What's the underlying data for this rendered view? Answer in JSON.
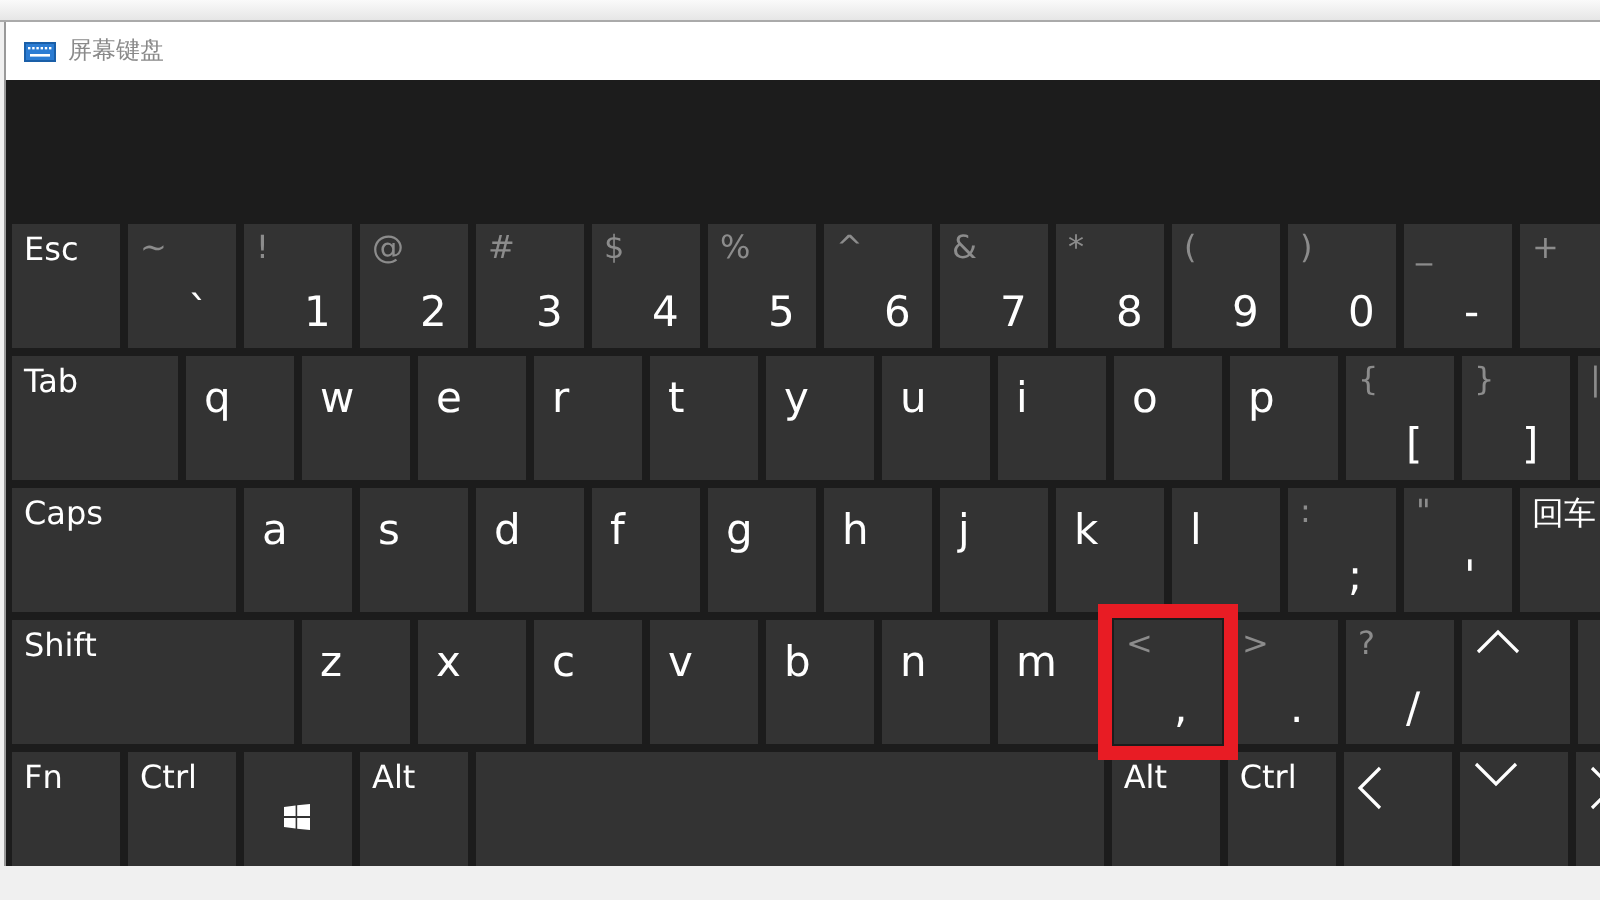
{
  "window": {
    "title": "屏幕键盘"
  },
  "rows": [
    {
      "keys": [
        {
          "kind": "func",
          "label": "Esc"
        },
        {
          "kind": "char",
          "shift": "~",
          "main": "`"
        },
        {
          "kind": "char",
          "shift": "!",
          "main": "1"
        },
        {
          "kind": "char",
          "shift": "@",
          "main": "2"
        },
        {
          "kind": "char",
          "shift": "#",
          "main": "3"
        },
        {
          "kind": "char",
          "shift": "$",
          "main": "4"
        },
        {
          "kind": "char",
          "shift": "%",
          "main": "5"
        },
        {
          "kind": "char",
          "shift": "^",
          "main": "6"
        },
        {
          "kind": "char",
          "shift": "&",
          "main": "7"
        },
        {
          "kind": "char",
          "shift": "*",
          "main": "8"
        },
        {
          "kind": "char",
          "shift": "(",
          "main": "9"
        },
        {
          "kind": "char",
          "shift": ")",
          "main": "0"
        },
        {
          "kind": "char",
          "shift": "_",
          "main": "-"
        },
        {
          "kind": "char",
          "shift": "+"
        }
      ]
    },
    {
      "keys": [
        {
          "kind": "func",
          "label": "Tab"
        },
        {
          "kind": "letter",
          "label": "q"
        },
        {
          "kind": "letter",
          "label": "w"
        },
        {
          "kind": "letter",
          "label": "e"
        },
        {
          "kind": "letter",
          "label": "r"
        },
        {
          "kind": "letter",
          "label": "t"
        },
        {
          "kind": "letter",
          "label": "y"
        },
        {
          "kind": "letter",
          "label": "u"
        },
        {
          "kind": "letter",
          "label": "i"
        },
        {
          "kind": "letter",
          "label": "o"
        },
        {
          "kind": "letter",
          "label": "p"
        },
        {
          "kind": "char",
          "shift": "{",
          "main": "["
        },
        {
          "kind": "char",
          "shift": "}",
          "main": "]"
        },
        {
          "kind": "char",
          "shift": "|"
        }
      ]
    },
    {
      "keys": [
        {
          "kind": "func",
          "label": "Caps"
        },
        {
          "kind": "letter",
          "label": "a"
        },
        {
          "kind": "letter",
          "label": "s"
        },
        {
          "kind": "letter",
          "label": "d"
        },
        {
          "kind": "letter",
          "label": "f"
        },
        {
          "kind": "letter",
          "label": "g"
        },
        {
          "kind": "letter",
          "label": "h"
        },
        {
          "kind": "letter",
          "label": "j"
        },
        {
          "kind": "letter",
          "label": "k"
        },
        {
          "kind": "letter",
          "label": "l"
        },
        {
          "kind": "char",
          "shift": ":",
          "main": ";"
        },
        {
          "kind": "char",
          "shift": "\"",
          "main": "'"
        },
        {
          "kind": "func",
          "label": "回车"
        }
      ]
    },
    {
      "keys": [
        {
          "kind": "func",
          "label": "Shift"
        },
        {
          "kind": "letter",
          "label": "z"
        },
        {
          "kind": "letter",
          "label": "x"
        },
        {
          "kind": "letter",
          "label": "c"
        },
        {
          "kind": "letter",
          "label": "v"
        },
        {
          "kind": "letter",
          "label": "b"
        },
        {
          "kind": "letter",
          "label": "n"
        },
        {
          "kind": "letter",
          "label": "m"
        },
        {
          "kind": "char",
          "shift": "<",
          "main": ",",
          "highlighted": true
        },
        {
          "kind": "char",
          "shift": ">",
          "main": "."
        },
        {
          "kind": "char",
          "shift": "?",
          "main": "/"
        },
        {
          "kind": "up"
        },
        {
          "kind": "blank"
        }
      ]
    },
    {
      "keys": [
        {
          "kind": "func",
          "label": "Fn"
        },
        {
          "kind": "func",
          "label": "Ctrl"
        },
        {
          "kind": "win"
        },
        {
          "kind": "func",
          "label": "Alt"
        },
        {
          "kind": "blank"
        },
        {
          "kind": "func",
          "label": "Alt"
        },
        {
          "kind": "func",
          "label": "Ctrl"
        },
        {
          "kind": "left"
        },
        {
          "kind": "down"
        },
        {
          "kind": "right"
        }
      ]
    }
  ]
}
